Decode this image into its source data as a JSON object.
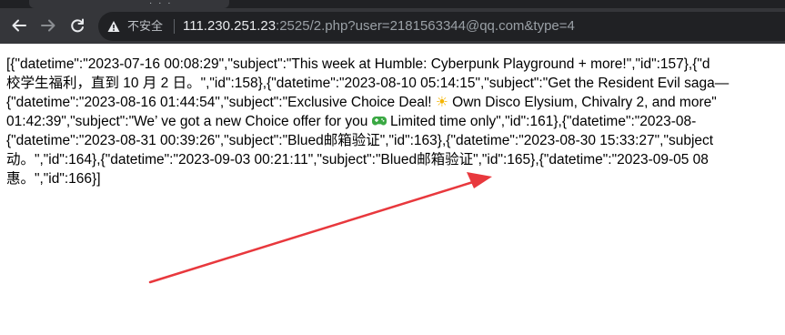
{
  "browser": {
    "security_label": "不安全",
    "url_host": "111.230.251.23",
    "url_rest": ":2525/2.php?user=2181563344@qq.com&type=4"
  },
  "icons": {
    "back": "back-arrow-icon",
    "forward": "forward-arrow-icon",
    "reload": "reload-icon",
    "warning": "warning-triangle-icon",
    "sun": "sun-emoji-icon",
    "gamepad": "gamepad-emoji-icon"
  },
  "colors": {
    "chrome_bg": "#35363a",
    "omnibox_bg": "#202124",
    "annotation_arrow": "#e8383d"
  },
  "json_text": {
    "line1": "[{\"datetime\":\"2023-07-16 00:08:29\",\"subject\":\"This week at Humble: Cyberpunk Playground + more!\",\"id\":157},{\"d",
    "line2": "校学生福利，直到 10 月 2 日。\",\"id\":158},{\"datetime\":\"2023-08-10 05:14:15\",\"subject\":\"Get the Resident Evil saga—",
    "line3a": "{\"datetime\":\"2023-08-16 01:44:54\",\"subject\":\"Exclusive Choice Deal! ",
    "line3_emoji": "☀",
    "line3b": " Own Disco Elysium, Chivalry 2, and more\"",
    "line4a": "01:42:39\",\"subject\":\"We’ ve got a new Choice offer for you ",
    "line4_emoji": "🎮",
    "line4b": " Limited time only\",\"id\":161},{\"datetime\":\"2023-08-",
    "line5": "{\"datetime\":\"2023-08-31 00:39:26\",\"subject\":\"Blued邮箱验证\",\"id\":163},{\"datetime\":\"2023-08-30 15:33:27\",\"subject",
    "line6": "动。\",\"id\":164},{\"datetime\":\"2023-09-03 00:21:11\",\"subject\":\"Blued邮箱验证\",\"id\":165},{\"datetime\":\"2023-09-05 08",
    "line7": "惠。\",\"id\":166}]"
  }
}
